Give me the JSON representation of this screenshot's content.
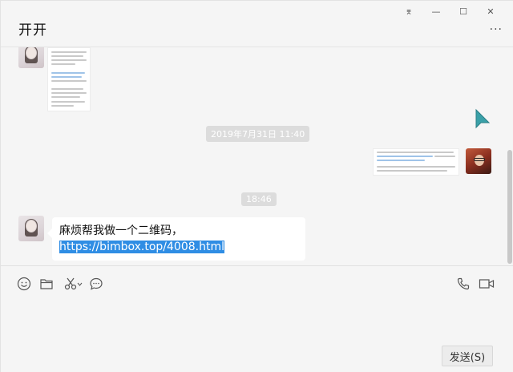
{
  "window": {
    "controls": [
      "⌆",
      "—",
      "☐",
      "✕"
    ]
  },
  "header": {
    "title": "开开",
    "more": "···"
  },
  "messages": {
    "time1": "2019年7月31日 11:40",
    "time2": "18:46",
    "text_plain": "麻烦帮我做一个二维码，",
    "text_link": "https://bimbox.top/4008.html"
  },
  "toolbar": {
    "tools": [
      "emoji-icon",
      "folder-icon",
      "scissors-icon",
      "chat-bubble-icon",
      "phone-icon",
      "video-icon"
    ]
  },
  "input": {
    "send_label": "发送(S)"
  },
  "colors": {
    "link_highlight": "#2f8de4",
    "background": "#f5f5f5",
    "cursor": "#3aa0a8"
  }
}
